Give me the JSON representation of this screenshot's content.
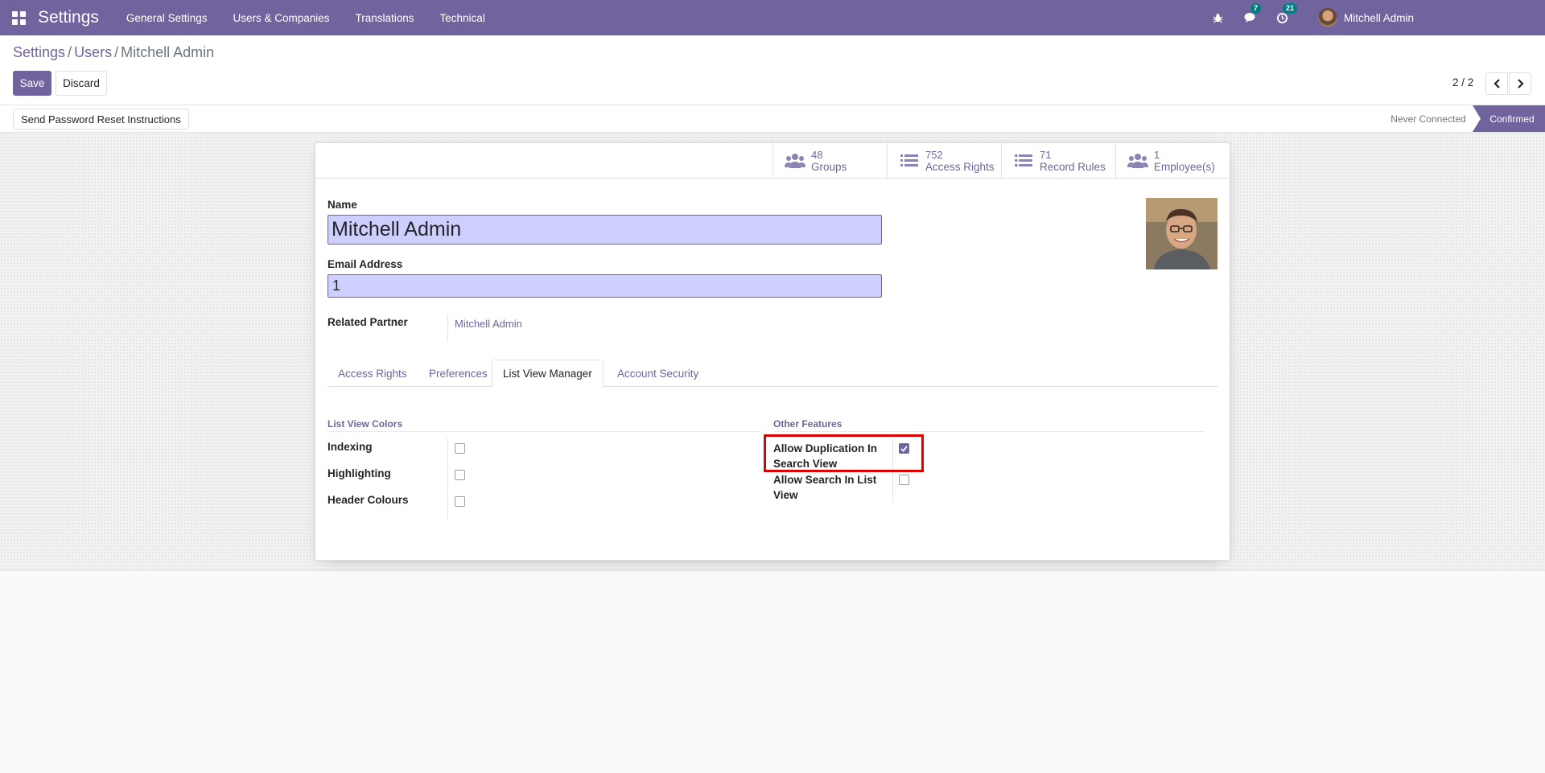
{
  "navbar": {
    "app_name": "Settings",
    "menu": [
      "General Settings",
      "Users & Companies",
      "Translations",
      "Technical"
    ],
    "messages_badge": "7",
    "activities_badge": "21",
    "user_name": "Mitchell Admin",
    "icons": [
      "apps-grid-icon",
      "bug-icon",
      "chat-icon",
      "clock-icon"
    ]
  },
  "breadcrumb": {
    "root": "Settings",
    "parent": "Users",
    "current": "Mitchell Admin"
  },
  "actions": {
    "save": "Save",
    "discard": "Discard"
  },
  "pager": {
    "value": "2 / 2"
  },
  "statusbar": {
    "reset_button": "Send Password Reset Instructions",
    "stages": [
      "Never Connected",
      "Confirmed"
    ],
    "active_stage": "Confirmed"
  },
  "smart_buttons": [
    {
      "value": "48",
      "label": "Groups",
      "icon": "users-icon"
    },
    {
      "value": "752",
      "label": "Access Rights",
      "icon": "list-icon"
    },
    {
      "value": "71",
      "label": "Record Rules",
      "icon": "list-icon"
    },
    {
      "value": "1",
      "label": "Employee(s)",
      "icon": "users-icon"
    }
  ],
  "form": {
    "name_label": "Name",
    "name_value": "Mitchell Admin",
    "email_label": "Email Address",
    "email_value": "1",
    "partner_label": "Related Partner",
    "partner_value": "Mitchell Admin"
  },
  "tabs": [
    "Access Rights",
    "Preferences",
    "List View Manager",
    "Account Security"
  ],
  "active_tab": "List View Manager",
  "list_view_colors": {
    "title": "List View Colors",
    "fields": [
      {
        "label": "Indexing",
        "checked": false
      },
      {
        "label": "Highlighting",
        "checked": false
      },
      {
        "label": "Header Colours",
        "checked": false
      }
    ]
  },
  "other_features": {
    "title": "Other Features",
    "fields": [
      {
        "label_line1": "Allow Duplication In",
        "label_line2": "Search View",
        "checked": true
      },
      {
        "label_line1": "Allow Search In List",
        "label_line2": "View",
        "checked": false
      }
    ]
  },
  "colors": {
    "primary": "#71639e",
    "input_bg": "#cfcfff",
    "badge": "#017e84",
    "highlight": "#e00000"
  }
}
